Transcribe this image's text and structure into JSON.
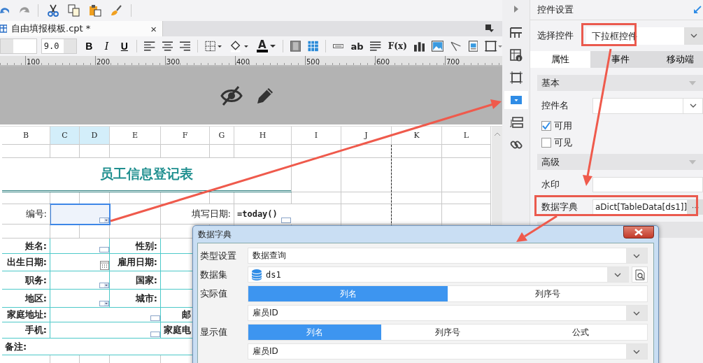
{
  "document_tab": {
    "title": "自由填报模板.cpt *",
    "close": "×"
  },
  "format_bar": {
    "font_size": "9.0",
    "bold": "B",
    "italic": "I",
    "underline": "U",
    "font_color": "A",
    "text_widget": "ab",
    "formula": "F(x)"
  },
  "ruler": {
    "ticks": [
      "100",
      "200",
      "300",
      "400",
      "500",
      "600",
      "700"
    ]
  },
  "sheet": {
    "columns": [
      {
        "label": "B",
        "selected": false
      },
      {
        "label": "C",
        "selected": true
      },
      {
        "label": "D",
        "selected": true
      },
      {
        "label": "E",
        "selected": false
      },
      {
        "label": "F",
        "selected": false
      },
      {
        "label": "G",
        "selected": false
      },
      {
        "label": "H",
        "selected": false
      },
      {
        "label": "I",
        "selected": false
      },
      {
        "label": "J",
        "selected": false
      },
      {
        "label": "K",
        "selected": false
      },
      {
        "label": "L",
        "selected": false
      }
    ],
    "cells": [
      {
        "kind": "title",
        "text": "员工信息登记表"
      },
      {
        "kind": "plain_label",
        "text": "编号:"
      },
      {
        "kind": "plain_label",
        "text": "填写日期:"
      },
      {
        "kind": "formula",
        "text": "=today()"
      },
      {
        "kind": "field_label",
        "text": "姓名:"
      },
      {
        "kind": "field_label",
        "text": "性别:"
      },
      {
        "kind": "field_label",
        "text": "出生日期:"
      },
      {
        "kind": "field_label",
        "text": "雇用日期:"
      },
      {
        "kind": "field_label",
        "text": "职务:"
      },
      {
        "kind": "field_label",
        "text": "国家:"
      },
      {
        "kind": "field_label",
        "text": "地区:"
      },
      {
        "kind": "field_label",
        "text": "城市:"
      },
      {
        "kind": "field_label",
        "text": "家庭地址:"
      },
      {
        "kind": "field_label",
        "text": "邮"
      },
      {
        "kind": "field_label",
        "text": "手机:"
      },
      {
        "kind": "field_label",
        "text": "家庭电"
      },
      {
        "kind": "note",
        "text": "备注:"
      }
    ]
  },
  "widget_strip": {
    "items": [
      {
        "selected": false
      },
      {
        "selected": false
      },
      {
        "selected": false
      },
      {
        "selected": true
      },
      {
        "selected": false
      },
      {
        "selected": false
      }
    ]
  },
  "side_panel": {
    "title": "控件设置",
    "widget_label": "选择控件",
    "widget_value": "下拉框控件",
    "tabs": [
      {
        "label": "属性",
        "selected": true
      },
      {
        "label": "事件",
        "selected": false
      },
      {
        "label": "移动端",
        "selected": false
      }
    ],
    "rows": [
      {
        "kind": "section",
        "label": "基本"
      },
      {
        "kind": "combo",
        "label": "控件名"
      },
      {
        "kind": "checkbox",
        "label": "可用",
        "checked": true
      },
      {
        "kind": "checkbox",
        "label": "可见",
        "checked": false
      },
      {
        "kind": "section",
        "label": "高级"
      },
      {
        "kind": "input",
        "label": "水印"
      },
      {
        "kind": "dict",
        "label": "数据字典",
        "value": "aDict[TableData[ds1]]",
        "button": "···"
      },
      {
        "kind": "section"
      }
    ]
  },
  "dialog": {
    "title": "数据字典",
    "rows": [
      {
        "kind": "select",
        "label": "类型设置",
        "value": "数据查询"
      },
      {
        "kind": "dataset",
        "label": "数据集",
        "value": "ds1"
      },
      {
        "kind": "segments",
        "label": "实际值",
        "segments": [
          {
            "label": "列名",
            "selected": true
          },
          {
            "label": "列序号",
            "selected": false
          }
        ]
      },
      {
        "kind": "select",
        "value": "雇员ID"
      },
      {
        "kind": "segments",
        "label": "显示值",
        "segments": [
          {
            "label": "列名",
            "selected": true
          },
          {
            "label": "列序号",
            "selected": false
          },
          {
            "label": "公式",
            "selected": false
          }
        ]
      },
      {
        "kind": "select",
        "value": "雇员ID"
      }
    ]
  }
}
